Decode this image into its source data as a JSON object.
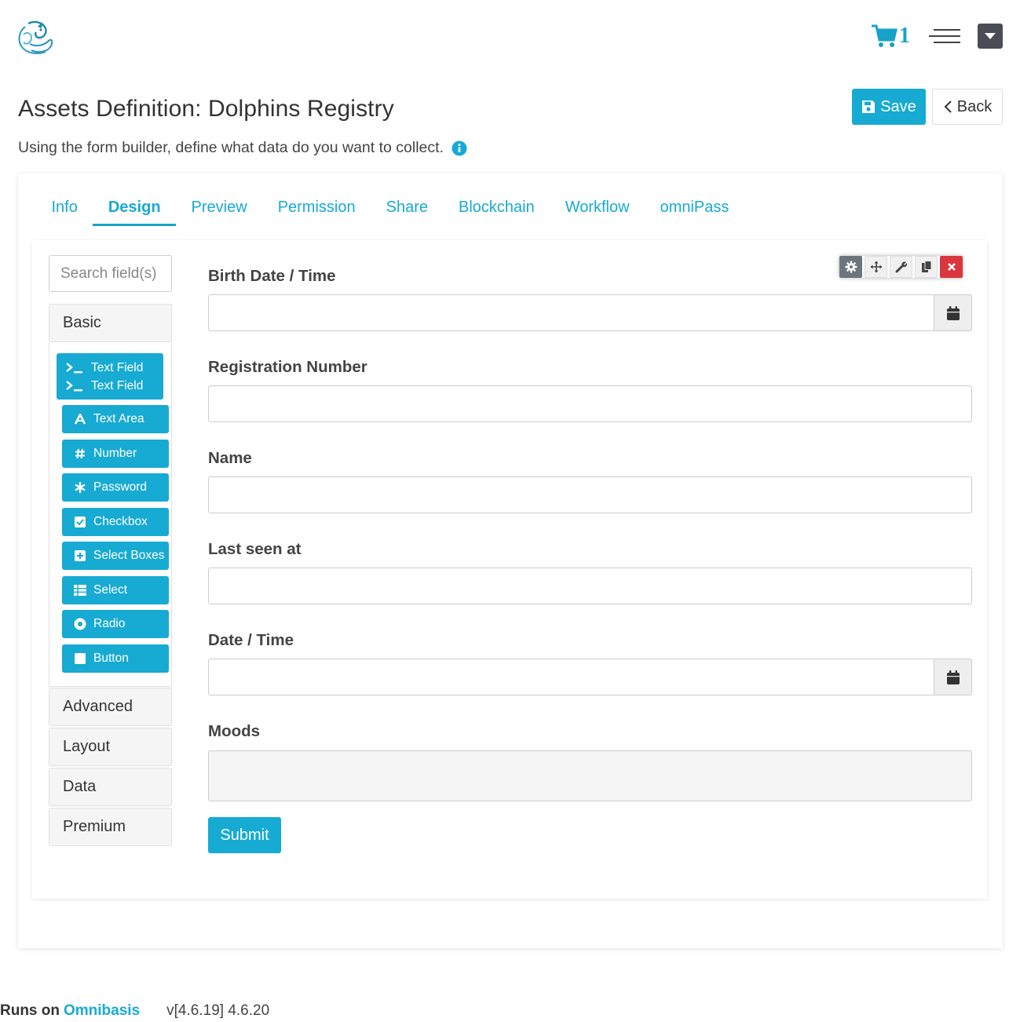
{
  "app": {
    "logo_icon": "dragon-logo-icon",
    "cart": {
      "icon": "shopping-cart-icon",
      "count": "1"
    },
    "menu_icon": "hamburger-menu-icon",
    "dropdown_icon": "caret-down-icon"
  },
  "header": {
    "title": "Assets Definition: Dolphins Registry",
    "subtitle": "Using the form builder, define what data do you want to collect.",
    "save_label": "Save",
    "back_label": "Back"
  },
  "tabs": [
    {
      "label": "Info"
    },
    {
      "label": "Design",
      "active": true
    },
    {
      "label": "Preview"
    },
    {
      "label": "Permission"
    },
    {
      "label": "Share"
    },
    {
      "label": "Blockchain"
    },
    {
      "label": "Workflow"
    },
    {
      "label": "omniPass"
    }
  ],
  "sidebar": {
    "search_placeholder": "Search field(s)",
    "groups": [
      "Basic",
      "Advanced",
      "Layout",
      "Data",
      "Premium"
    ],
    "dragging": [
      "Text Field",
      "Text Field"
    ],
    "components": [
      {
        "label": "Text Area",
        "icon": "font-icon"
      },
      {
        "label": "Number",
        "icon": "hashtag-icon"
      },
      {
        "label": "Password",
        "icon": "asterisk-icon"
      },
      {
        "label": "Checkbox",
        "icon": "check-square-icon"
      },
      {
        "label": "Select Boxes",
        "icon": "plus-square-icon"
      },
      {
        "label": "Select",
        "icon": "list-icon"
      },
      {
        "label": "Radio",
        "icon": "dot-circle-icon"
      },
      {
        "label": "Button",
        "icon": "stop-icon"
      }
    ]
  },
  "form": {
    "fields": [
      {
        "label": "Birth Date / Time",
        "type": "datetime"
      },
      {
        "label": "Registration Number",
        "type": "text"
      },
      {
        "label": "Name",
        "type": "text"
      },
      {
        "label": "Last seen at",
        "type": "text"
      },
      {
        "label": "Date / Time",
        "type": "datetime"
      },
      {
        "label": "Moods",
        "type": "textarea"
      }
    ],
    "submit_label": "Submit"
  },
  "footer": {
    "runs_on": "Runs on",
    "brand": "Omnibasis",
    "version": "v[4.6.19] 4.6.20"
  },
  "colors": {
    "accent": "#17aad2",
    "danger": "#d9363e"
  }
}
